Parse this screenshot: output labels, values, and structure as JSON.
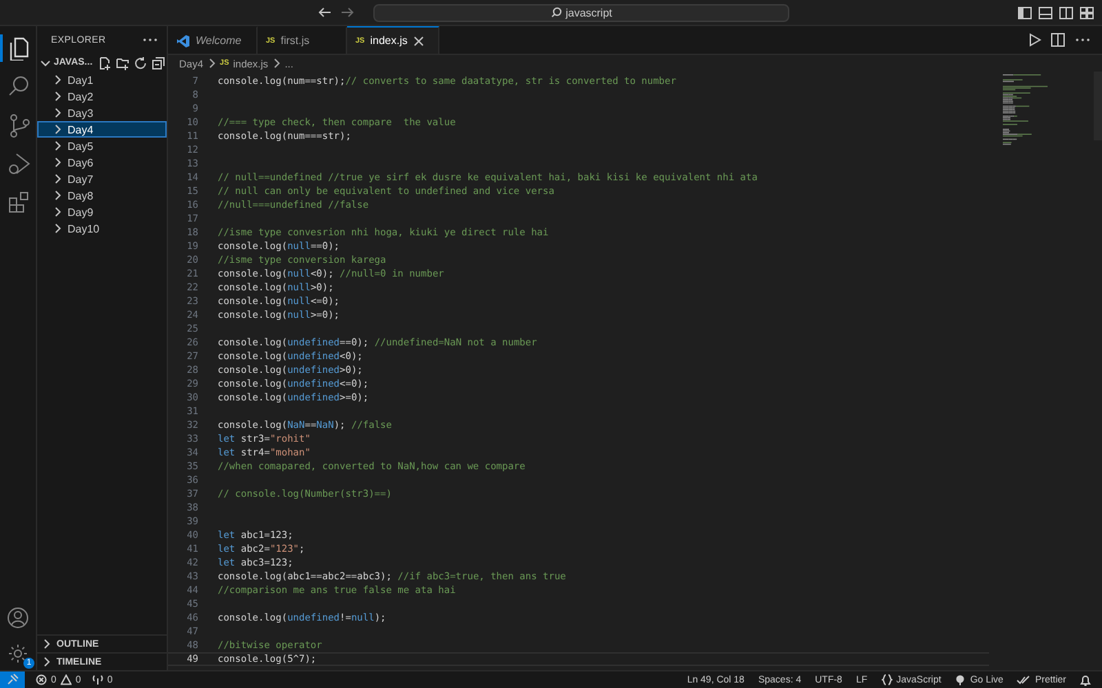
{
  "title_bar": {
    "search": "javascript"
  },
  "activity_bar": {
    "items": [
      {
        "kind": "files",
        "selected": true
      },
      {
        "kind": "search",
        "selected": false
      },
      {
        "kind": "source-control",
        "selected": false
      },
      {
        "kind": "run",
        "selected": false
      },
      {
        "kind": "extensions",
        "selected": false
      }
    ],
    "settings_badge": "1"
  },
  "sidebar": {
    "title": "EXPLORER",
    "folder": "JAVAS...",
    "items": [
      {
        "label": "Day1",
        "selected": false
      },
      {
        "label": "Day2",
        "selected": false
      },
      {
        "label": "Day3",
        "selected": false
      },
      {
        "label": "Day4",
        "selected": true
      },
      {
        "label": "Day5",
        "selected": false
      },
      {
        "label": "Day6",
        "selected": false
      },
      {
        "label": "Day7",
        "selected": false
      },
      {
        "label": "Day8",
        "selected": false
      },
      {
        "label": "Day9",
        "selected": false
      },
      {
        "label": "Day10",
        "selected": false
      }
    ],
    "sections": [
      "OUTLINE",
      "TIMELINE"
    ]
  },
  "tabs": [
    {
      "label": "Welcome",
      "kind": "welcome",
      "preview": true,
      "selected": false
    },
    {
      "label": "first.js",
      "kind": "js",
      "icon_text": "JS",
      "preview": false,
      "selected": false
    },
    {
      "label": "index.js",
      "kind": "js",
      "icon_text": "JS",
      "preview": false,
      "selected": true
    }
  ],
  "breadcrumbs": [
    {
      "label": "Day4",
      "kind": "folder"
    },
    {
      "label": "index.js",
      "kind": "file",
      "icon_text": "JS"
    },
    {
      "label": "...",
      "kind": "more"
    }
  ],
  "editor": {
    "lines": [
      {
        "number": "7",
        "current": false,
        "code": [
          {
            "kind": "plain",
            "text": "console.log(num==str);"
          },
          {
            "kind": "comment",
            "text": "// converts to same daatatype, str is converted to number"
          }
        ]
      },
      {
        "number": "8",
        "current": false
      },
      {
        "number": "9",
        "current": false
      },
      {
        "number": "10",
        "current": false,
        "code": [
          {
            "kind": "comment",
            "text": "//=== type check, then compare  the value"
          }
        ]
      },
      {
        "number": "11",
        "current": false,
        "code": [
          {
            "kind": "plain",
            "text": "console.log(num===str);"
          }
        ]
      },
      {
        "number": "12",
        "current": false
      },
      {
        "number": "13",
        "current": false
      },
      {
        "number": "14",
        "current": false,
        "code": [
          {
            "kind": "comment",
            "text": "// null==undefined //true ye sirf ek dusre ke equivalent hai, baki kisi ke equivalent nhi ata"
          }
        ]
      },
      {
        "number": "15",
        "current": false,
        "code": [
          {
            "kind": "comment",
            "text": "// null can only be equivalent to undefined and vice versa"
          }
        ]
      },
      {
        "number": "16",
        "current": false,
        "code": [
          {
            "kind": "comment",
            "text": "//null===undefined //false"
          }
        ]
      },
      {
        "number": "17",
        "current": false
      },
      {
        "number": "18",
        "current": false,
        "code": [
          {
            "kind": "comment",
            "text": "//isme type convesrion nhi hoga, kiuki ye direct rule hai"
          }
        ]
      },
      {
        "number": "19",
        "current": false,
        "code": [
          {
            "kind": "plain",
            "text": "console.log("
          },
          {
            "kind": "constant",
            "text": "null"
          },
          {
            "kind": "plain",
            "text": "==0);"
          }
        ]
      },
      {
        "number": "20",
        "current": false,
        "code": [
          {
            "kind": "comment",
            "text": "//isme type conversion karega"
          }
        ]
      },
      {
        "number": "21",
        "current": false,
        "code": [
          {
            "kind": "plain",
            "text": "console.log("
          },
          {
            "kind": "constant",
            "text": "null"
          },
          {
            "kind": "plain",
            "text": "<0); "
          },
          {
            "kind": "comment",
            "text": "//null=0 in number"
          }
        ]
      },
      {
        "number": "22",
        "current": false,
        "code": [
          {
            "kind": "plain",
            "text": "console.log("
          },
          {
            "kind": "constant",
            "text": "null"
          },
          {
            "kind": "plain",
            "text": ">0);"
          }
        ]
      },
      {
        "number": "23",
        "current": false,
        "code": [
          {
            "kind": "plain",
            "text": "console.log("
          },
          {
            "kind": "constant",
            "text": "null"
          },
          {
            "kind": "plain",
            "text": "<=0);"
          }
        ]
      },
      {
        "number": "24",
        "current": false,
        "code": [
          {
            "kind": "plain",
            "text": "console.log("
          },
          {
            "kind": "constant",
            "text": "null"
          },
          {
            "kind": "plain",
            "text": ">=0);"
          }
        ]
      },
      {
        "number": "25",
        "current": false
      },
      {
        "number": "26",
        "current": false,
        "code": [
          {
            "kind": "plain",
            "text": "console.log("
          },
          {
            "kind": "constant",
            "text": "undefined"
          },
          {
            "kind": "plain",
            "text": "==0); "
          },
          {
            "kind": "comment",
            "text": "//undefined=NaN not a number"
          }
        ]
      },
      {
        "number": "27",
        "current": false,
        "code": [
          {
            "kind": "plain",
            "text": "console.log("
          },
          {
            "kind": "constant",
            "text": "undefined"
          },
          {
            "kind": "plain",
            "text": "<0);"
          }
        ]
      },
      {
        "number": "28",
        "current": false,
        "code": [
          {
            "kind": "plain",
            "text": "console.log("
          },
          {
            "kind": "constant",
            "text": "undefined"
          },
          {
            "kind": "plain",
            "text": ">0);"
          }
        ]
      },
      {
        "number": "29",
        "current": false,
        "code": [
          {
            "kind": "plain",
            "text": "console.log("
          },
          {
            "kind": "constant",
            "text": "undefined"
          },
          {
            "kind": "plain",
            "text": "<=0);"
          }
        ]
      },
      {
        "number": "30",
        "current": false,
        "code": [
          {
            "kind": "plain",
            "text": "console.log("
          },
          {
            "kind": "constant",
            "text": "undefined"
          },
          {
            "kind": "plain",
            "text": ">=0);"
          }
        ]
      },
      {
        "number": "31",
        "current": false
      },
      {
        "number": "32",
        "current": false,
        "code": [
          {
            "kind": "plain",
            "text": "console.log("
          },
          {
            "kind": "constant",
            "text": "NaN"
          },
          {
            "kind": "plain",
            "text": "=="
          },
          {
            "kind": "constant",
            "text": "NaN"
          },
          {
            "kind": "plain",
            "text": "); "
          },
          {
            "kind": "comment",
            "text": "//false"
          }
        ]
      },
      {
        "number": "33",
        "current": false,
        "code": [
          {
            "kind": "keyword",
            "text": "let"
          },
          {
            "kind": "plain",
            "text": " str3="
          },
          {
            "kind": "string",
            "text": "\"rohit\""
          }
        ]
      },
      {
        "number": "34",
        "current": false,
        "code": [
          {
            "kind": "keyword",
            "text": "let"
          },
          {
            "kind": "plain",
            "text": " str4="
          },
          {
            "kind": "string",
            "text": "\"mohan\""
          }
        ]
      },
      {
        "number": "35",
        "current": false,
        "code": [
          {
            "kind": "comment",
            "text": "//when comapared, converted to NaN,how can we compare"
          }
        ]
      },
      {
        "number": "36",
        "current": false
      },
      {
        "number": "37",
        "current": false,
        "code": [
          {
            "kind": "comment",
            "text": "// console.log(Number(str3)==)"
          }
        ]
      },
      {
        "number": "38",
        "current": false
      },
      {
        "number": "39",
        "current": false
      },
      {
        "number": "40",
        "current": false,
        "code": [
          {
            "kind": "keyword",
            "text": "let"
          },
          {
            "kind": "plain",
            "text": " abc1=123;"
          }
        ]
      },
      {
        "number": "41",
        "current": false,
        "code": [
          {
            "kind": "keyword",
            "text": "let"
          },
          {
            "kind": "plain",
            "text": " abc2="
          },
          {
            "kind": "string",
            "text": "\"123\""
          },
          {
            "kind": "plain",
            "text": ";"
          }
        ]
      },
      {
        "number": "42",
        "current": false,
        "code": [
          {
            "kind": "keyword",
            "text": "let"
          },
          {
            "kind": "plain",
            "text": " abc3=123;"
          }
        ]
      },
      {
        "number": "43",
        "current": false,
        "code": [
          {
            "kind": "plain",
            "text": "console.log(abc1==abc2==abc3); "
          },
          {
            "kind": "comment",
            "text": "//if abc3=true, then ans true"
          }
        ]
      },
      {
        "number": "44",
        "current": false,
        "code": [
          {
            "kind": "comment",
            "text": "//comparison me ans true false me ata hai"
          }
        ]
      },
      {
        "number": "45",
        "current": false
      },
      {
        "number": "46",
        "current": false,
        "code": [
          {
            "kind": "plain",
            "text": "console.log("
          },
          {
            "kind": "constant",
            "text": "undefined"
          },
          {
            "kind": "plain",
            "text": "!="
          },
          {
            "kind": "constant",
            "text": "null"
          },
          {
            "kind": "plain",
            "text": ");"
          }
        ]
      },
      {
        "number": "47",
        "current": false
      },
      {
        "number": "48",
        "current": false,
        "code": [
          {
            "kind": "comment",
            "text": "//bitwise operator"
          }
        ]
      },
      {
        "number": "49",
        "current": true,
        "code": [
          {
            "kind": "plain",
            "text": "console.log(5^7);"
          }
        ]
      }
    ]
  },
  "status_bar": {
    "errors": "0",
    "warnings": "0",
    "ports": "0",
    "items": [
      {
        "kind": "text",
        "label": "Ln 49, Col 18"
      },
      {
        "kind": "text",
        "label": "Spaces: 4"
      },
      {
        "kind": "text",
        "label": "UTF-8"
      },
      {
        "kind": "text",
        "label": "LF"
      },
      {
        "kind": "language",
        "label": "JavaScript"
      },
      {
        "kind": "golive",
        "label": "Go Live"
      },
      {
        "kind": "prettier",
        "label": "Prettier"
      },
      {
        "kind": "bell"
      }
    ]
  }
}
